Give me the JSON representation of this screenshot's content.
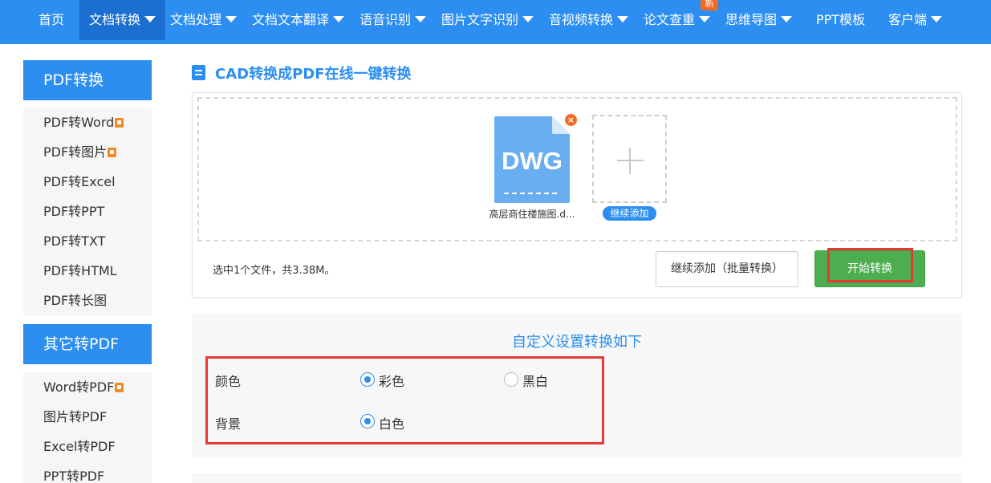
{
  "nav": {
    "items": [
      {
        "label": "首页",
        "caret": false
      },
      {
        "label": "文档转换",
        "caret": true
      },
      {
        "label": "文档处理",
        "caret": true
      },
      {
        "label": "文档文本翻译",
        "caret": true
      },
      {
        "label": "语音识别",
        "caret": true
      },
      {
        "label": "图片文字识别",
        "caret": true
      },
      {
        "label": "音视频转换",
        "caret": true
      },
      {
        "label": "论文查重",
        "caret": true
      },
      {
        "label": "思维导图",
        "caret": true
      },
      {
        "label": "PPT模板",
        "caret": false
      },
      {
        "label": "客户端",
        "caret": true
      }
    ],
    "active_item": "文档转换",
    "new_badge": "新"
  },
  "sidebar": {
    "sections": [
      {
        "header": "PDF转换",
        "items": [
          {
            "label": "PDF转Word",
            "vip": true
          },
          {
            "label": "PDF转图片",
            "vip": true
          },
          {
            "label": "PDF转Excel",
            "vip": false
          },
          {
            "label": "PDF转PPT",
            "vip": false
          },
          {
            "label": "PDF转TXT",
            "vip": false
          },
          {
            "label": "PDF转HTML",
            "vip": false
          },
          {
            "label": "PDF转长图",
            "vip": false
          }
        ]
      },
      {
        "header": "其它转PDF",
        "items": [
          {
            "label": "Word转PDF",
            "vip": true
          },
          {
            "label": "图片转PDF",
            "vip": false
          },
          {
            "label": "Excel转PDF",
            "vip": false
          },
          {
            "label": "PPT转PDF",
            "vip": false
          }
        ]
      }
    ]
  },
  "page": {
    "title": "CAD转换成PDF在线一键转换"
  },
  "upload": {
    "file": {
      "type_label": "DWG",
      "name": "高层商住楼施图.d...",
      "remove_symbol": "×"
    },
    "add_more_label": "继续添加",
    "summary": "选中1个文件，共3.38M。",
    "batch_add_label": "继续添加（批量转换）",
    "start_label": "开始转换"
  },
  "settings": {
    "title": "自定义设置转换如下",
    "options": [
      {
        "label": "颜色",
        "choices": [
          {
            "label": "彩色",
            "checked": true
          },
          {
            "label": "黑白",
            "checked": false
          }
        ]
      },
      {
        "label": "背景",
        "choices": [
          {
            "label": "白色",
            "checked": true
          }
        ]
      }
    ]
  },
  "colors": {
    "primary": "#2b8ef0",
    "primary_dark": "#1a6fd0",
    "success": "#4cae4f",
    "highlight": "#e53935",
    "badge": "#f26b24",
    "file_icon": "#6aaef2"
  }
}
